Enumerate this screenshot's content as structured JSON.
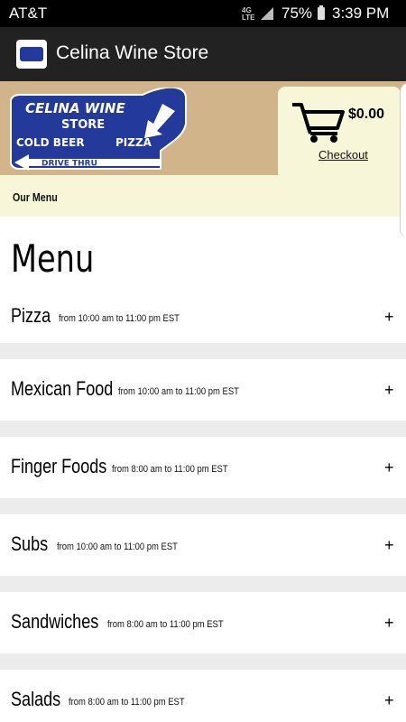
{
  "status_bar": {
    "carrier": "AT&T",
    "network": "4G LTE",
    "battery": "75%",
    "time": "3:39 PM"
  },
  "app_bar": {
    "title": "Celina Wine Store"
  },
  "header": {
    "logo_text": {
      "line1": "CELINA WINE",
      "line2": "STORE",
      "line3_left": "COLD BEER",
      "line3_right": "PIZZA",
      "line4": "DRIVE THRU"
    },
    "cart_total": "$0.00",
    "checkout_label": "Checkout",
    "our_menu_label": "Our Menu"
  },
  "menu": {
    "heading": "Menu",
    "categories": [
      {
        "name": "Pizza",
        "hours": "from 10:00 am to 11:00 pm EST",
        "expand": "+"
      },
      {
        "name": "Mexican Food",
        "hours": "from 10:00 am to 11:00 pm EST",
        "expand": "+"
      },
      {
        "name": "Finger Foods",
        "hours": "from 8:00 am to 11:00 pm EST",
        "expand": "+"
      },
      {
        "name": "Subs",
        "hours": "from 10:00 am to 11:00 pm EST",
        "expand": "+"
      },
      {
        "name": "Sandwiches",
        "hours": "from 8:00 am to 11:00 pm EST",
        "expand": "+"
      },
      {
        "name": "Salads",
        "hours": "from 8:00 am to 11:00 pm EST",
        "expand": "+"
      }
    ]
  },
  "colors": {
    "header_tan": "#d2b48a",
    "cream": "#f7f6d8",
    "logo_blue": "#233a9b",
    "app_bar": "#222222",
    "separator": "#ececec"
  }
}
